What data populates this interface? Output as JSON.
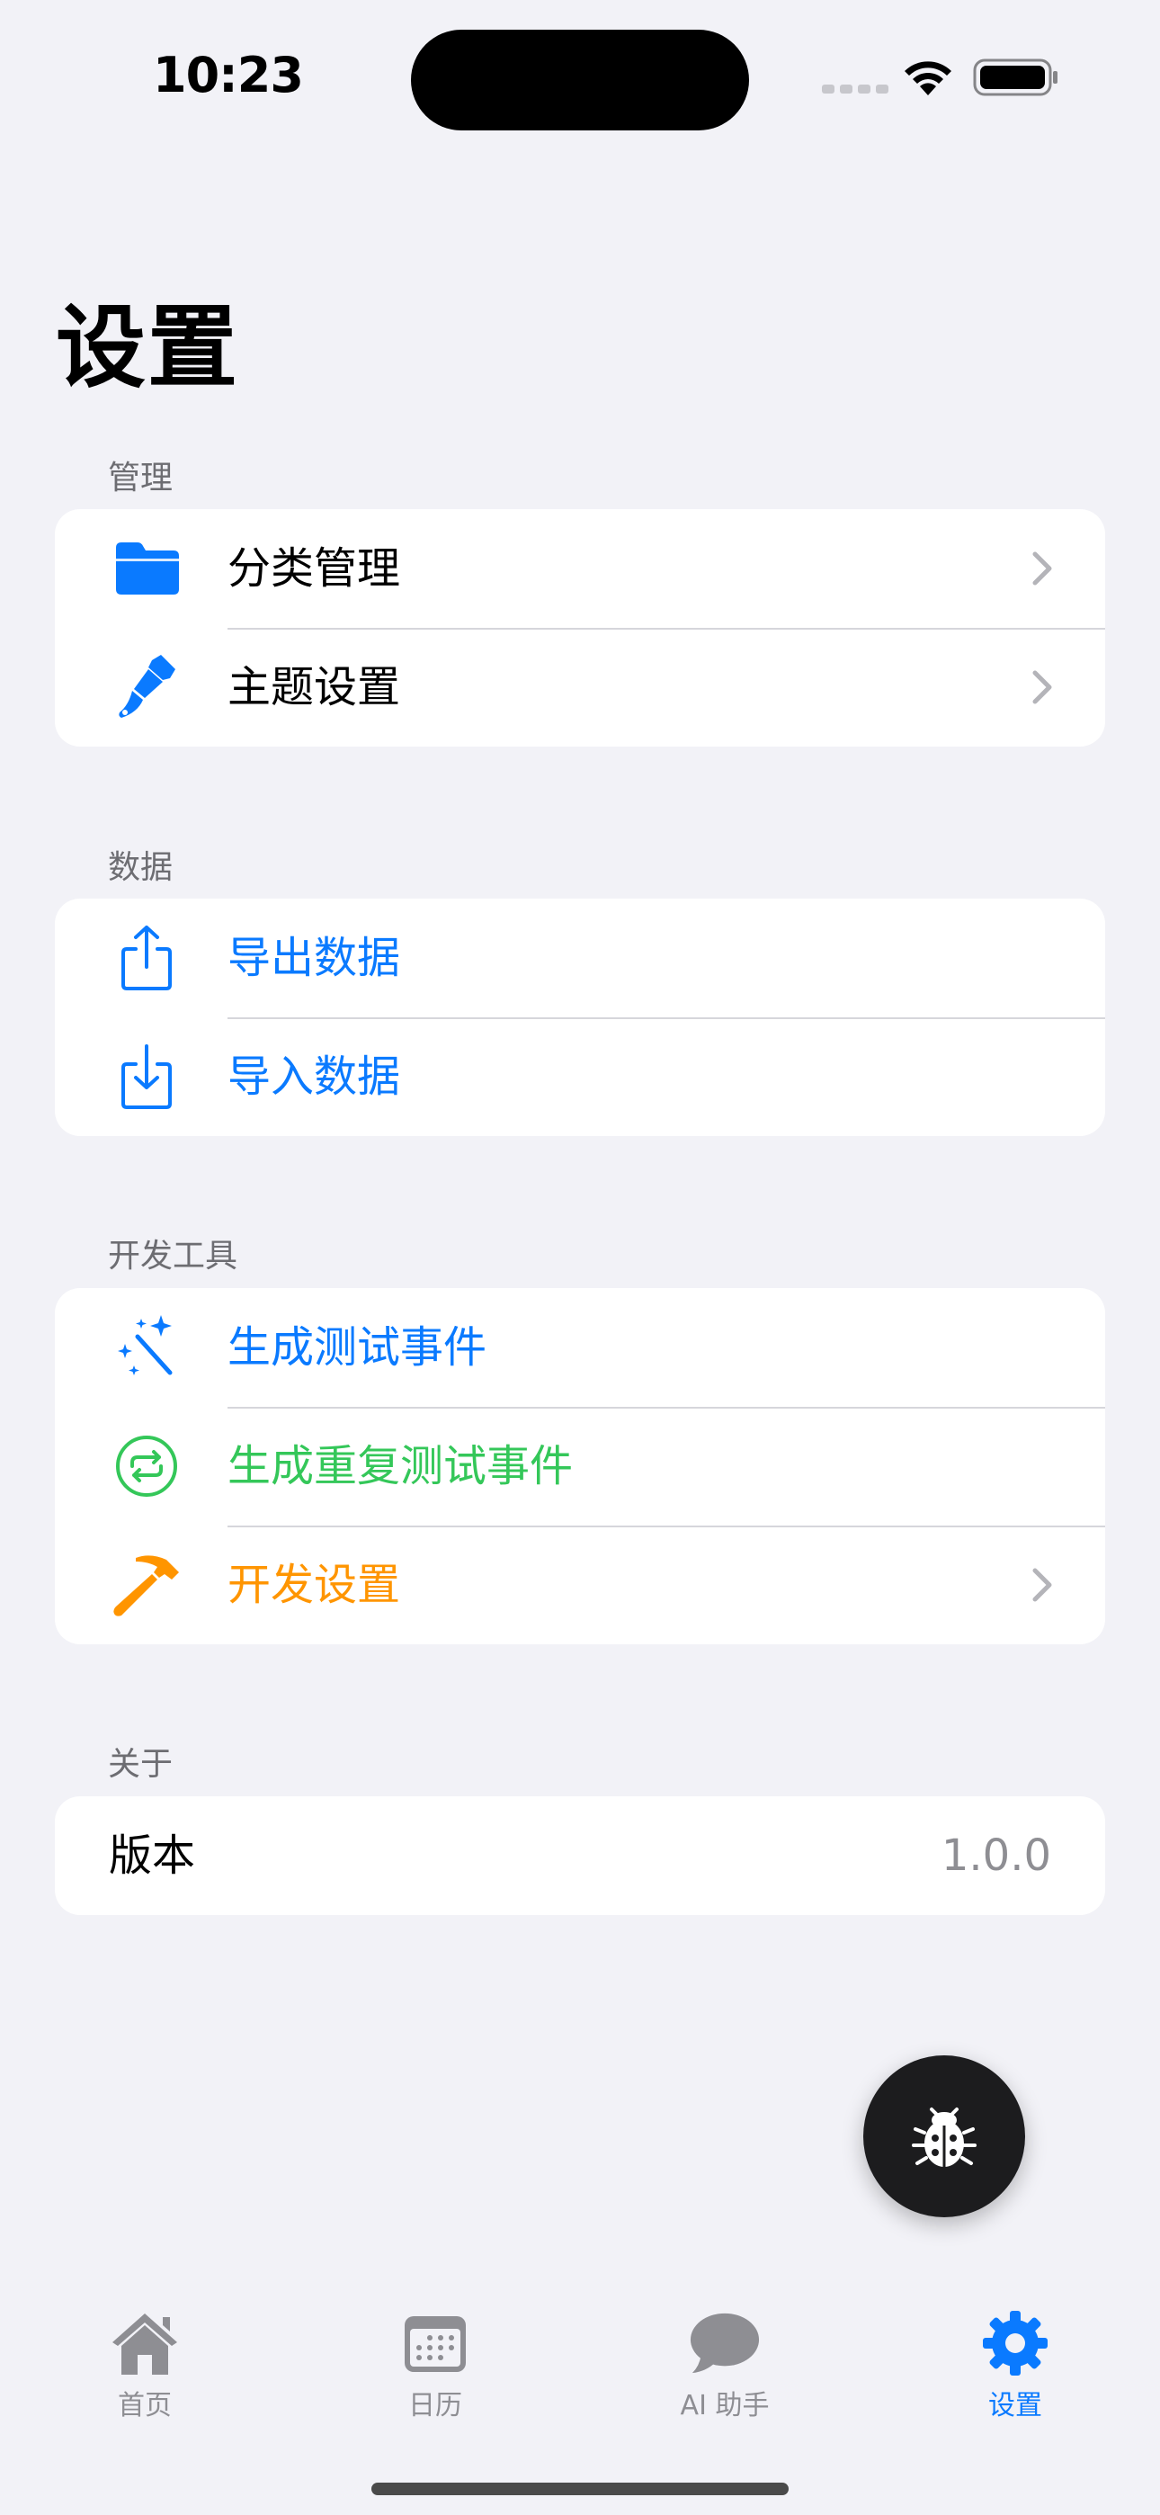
{
  "status_bar": {
    "time": "10:23"
  },
  "page": {
    "title": "设置"
  },
  "sections": [
    {
      "header": "管理",
      "rows": [
        {
          "label": "分类管理",
          "icon": "folder-icon",
          "color": "#000000",
          "chevron": true
        },
        {
          "label": "主题设置",
          "icon": "paintbrush-icon",
          "color": "#000000",
          "chevron": true
        }
      ]
    },
    {
      "header": "数据",
      "rows": [
        {
          "label": "导出数据",
          "icon": "share-upload-icon",
          "color": "#0a7aff",
          "chevron": false
        },
        {
          "label": "导入数据",
          "icon": "download-tray-icon",
          "color": "#0a7aff",
          "chevron": false
        }
      ]
    },
    {
      "header": "开发工具",
      "rows": [
        {
          "label": "生成测试事件",
          "icon": "magic-wand-icon",
          "color": "#0a7aff",
          "chevron": false
        },
        {
          "label": "生成重复测试事件",
          "icon": "repeat-circle-icon",
          "color": "#34c759",
          "chevron": false
        },
        {
          "label": "开发设置",
          "icon": "hammer-icon",
          "color": "#ff9500",
          "chevron": true
        }
      ]
    },
    {
      "header": "关于",
      "rows": [
        {
          "label": "版本",
          "value": "1.0.0"
        }
      ]
    }
  ],
  "fab": {
    "icon": "ladybug-icon"
  },
  "tab_bar": {
    "tabs": [
      {
        "label": "首页",
        "icon": "house-icon",
        "active": false
      },
      {
        "label": "日历",
        "icon": "calendar-icon",
        "active": false
      },
      {
        "label": "AI 助手",
        "icon": "chat-bubble-icon",
        "active": false
      },
      {
        "label": "设置",
        "icon": "gear-icon",
        "active": true
      }
    ]
  },
  "colors": {
    "accent": "#0a7aff",
    "green": "#34c759",
    "orange": "#ff9500",
    "background": "#f2f2f7"
  }
}
